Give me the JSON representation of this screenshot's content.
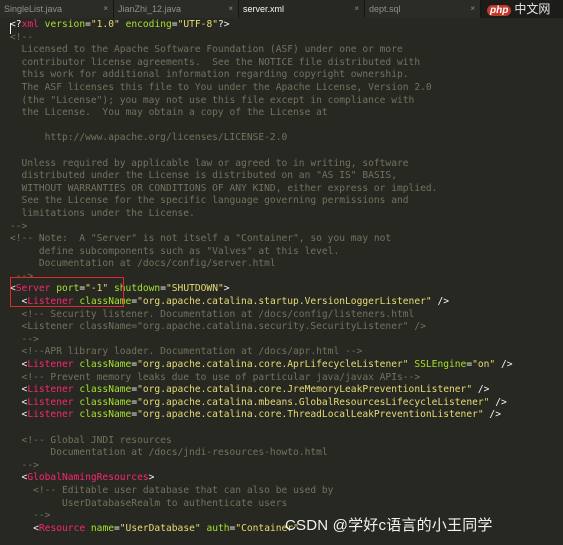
{
  "tabs": [
    {
      "label": "SingleList.java",
      "active": false
    },
    {
      "label": "JianZhi_12.java",
      "active": false
    },
    {
      "label": "server.xml",
      "active": true
    },
    {
      "label": "dept.sql",
      "active": false
    }
  ],
  "tab_close_glyph": "×",
  "logo": {
    "part1": "php",
    "part2": "中文网"
  },
  "watermark": "CSDN @学好c语言的小王同学",
  "lines": [
    [
      {
        "c": "p",
        "t": "<?"
      },
      {
        "c": "t",
        "t": "xml"
      },
      {
        "c": "p",
        "t": " "
      },
      {
        "c": "a",
        "t": "version"
      },
      {
        "c": "p",
        "t": "="
      },
      {
        "c": "s",
        "t": "\"1.0\""
      },
      {
        "c": "p",
        "t": " "
      },
      {
        "c": "a",
        "t": "encoding"
      },
      {
        "c": "p",
        "t": "="
      },
      {
        "c": "s",
        "t": "\"UTF-8\""
      },
      {
        "c": "p",
        "t": "?>"
      }
    ],
    [
      {
        "c": "c",
        "t": "<!--"
      }
    ],
    [
      {
        "c": "c",
        "t": "  Licensed to the Apache Software Foundation (ASF) under one or more"
      }
    ],
    [
      {
        "c": "c",
        "t": "  contributor license agreements.  See the NOTICE file distributed with"
      }
    ],
    [
      {
        "c": "c",
        "t": "  this work for additional information regarding copyright ownership."
      }
    ],
    [
      {
        "c": "c",
        "t": "  The ASF licenses this file to You under the Apache License, Version 2.0"
      }
    ],
    [
      {
        "c": "c",
        "t": "  (the \"License\"); you may not use this file except in compliance with"
      }
    ],
    [
      {
        "c": "c",
        "t": "  the License.  You may obtain a copy of the License at"
      }
    ],
    [
      {
        "c": "c",
        "t": ""
      }
    ],
    [
      {
        "c": "c",
        "t": "      http://www.apache.org/licenses/LICENSE-2.0"
      }
    ],
    [
      {
        "c": "c",
        "t": ""
      }
    ],
    [
      {
        "c": "c",
        "t": "  Unless required by applicable law or agreed to in writing, software"
      }
    ],
    [
      {
        "c": "c",
        "t": "  distributed under the License is distributed on an \"AS IS\" BASIS,"
      }
    ],
    [
      {
        "c": "c",
        "t": "  WITHOUT WARRANTIES OR CONDITIONS OF ANY KIND, either express or implied."
      }
    ],
    [
      {
        "c": "c",
        "t": "  See the License for the specific language governing permissions and"
      }
    ],
    [
      {
        "c": "c",
        "t": "  limitations under the License."
      }
    ],
    [
      {
        "c": "c",
        "t": "-->"
      }
    ],
    [
      {
        "c": "c",
        "t": "<!-- Note:  A \"Server\" is not itself a \"Container\", so you may not"
      }
    ],
    [
      {
        "c": "c",
        "t": "     define subcomponents such as \"Valves\" at this level."
      }
    ],
    [
      {
        "c": "c",
        "t": "     Documentation at /docs/config/server.html"
      }
    ],
    [
      {
        "c": "c",
        "t": " -->"
      }
    ],
    [
      {
        "c": "p",
        "t": "<"
      },
      {
        "c": "t",
        "t": "Server"
      },
      {
        "c": "p",
        "t": " "
      },
      {
        "c": "a",
        "t": "port"
      },
      {
        "c": "p",
        "t": "="
      },
      {
        "c": "s",
        "t": "\"-1\""
      },
      {
        "c": "p",
        "t": " "
      },
      {
        "c": "a",
        "t": "shutdown"
      },
      {
        "c": "p",
        "t": "="
      },
      {
        "c": "s",
        "t": "\"SHUTDOWN\""
      },
      {
        "c": "p",
        "t": ">"
      }
    ],
    [
      {
        "c": "p",
        "t": "  <"
      },
      {
        "c": "t",
        "t": "Listener"
      },
      {
        "c": "p",
        "t": " "
      },
      {
        "c": "a",
        "t": "className"
      },
      {
        "c": "p",
        "t": "="
      },
      {
        "c": "s",
        "t": "\"org.apache.catalina.startup.VersionLoggerListener\""
      },
      {
        "c": "p",
        "t": " />"
      }
    ],
    [
      {
        "c": "c",
        "t": "  <!-- Security listener. Documentation at /docs/config/listeners.html"
      }
    ],
    [
      {
        "c": "c",
        "t": "  <Listener className=\"org.apache.catalina.security.SecurityListener\" />"
      }
    ],
    [
      {
        "c": "c",
        "t": "  -->"
      }
    ],
    [
      {
        "c": "c",
        "t": "  <!--APR library loader. Documentation at /docs/apr.html -->"
      }
    ],
    [
      {
        "c": "p",
        "t": "  <"
      },
      {
        "c": "t",
        "t": "Listener"
      },
      {
        "c": "p",
        "t": " "
      },
      {
        "c": "a",
        "t": "className"
      },
      {
        "c": "p",
        "t": "="
      },
      {
        "c": "s",
        "t": "\"org.apache.catalina.core.AprLifecycleListener\""
      },
      {
        "c": "p",
        "t": " "
      },
      {
        "c": "a",
        "t": "SSLEngine"
      },
      {
        "c": "p",
        "t": "="
      },
      {
        "c": "s",
        "t": "\"on\""
      },
      {
        "c": "p",
        "t": " />"
      }
    ],
    [
      {
        "c": "c",
        "t": "  <!-- Prevent memory leaks due to use of particular java/javax APIs-->"
      }
    ],
    [
      {
        "c": "p",
        "t": "  <"
      },
      {
        "c": "t",
        "t": "Listener"
      },
      {
        "c": "p",
        "t": " "
      },
      {
        "c": "a",
        "t": "className"
      },
      {
        "c": "p",
        "t": "="
      },
      {
        "c": "s",
        "t": "\"org.apache.catalina.core.JreMemoryLeakPreventionListener\""
      },
      {
        "c": "p",
        "t": " />"
      }
    ],
    [
      {
        "c": "p",
        "t": "  <"
      },
      {
        "c": "t",
        "t": "Listener"
      },
      {
        "c": "p",
        "t": " "
      },
      {
        "c": "a",
        "t": "className"
      },
      {
        "c": "p",
        "t": "="
      },
      {
        "c": "s",
        "t": "\"org.apache.catalina.mbeans.GlobalResourcesLifecycleListener\""
      },
      {
        "c": "p",
        "t": " />"
      }
    ],
    [
      {
        "c": "p",
        "t": "  <"
      },
      {
        "c": "t",
        "t": "Listener"
      },
      {
        "c": "p",
        "t": " "
      },
      {
        "c": "a",
        "t": "className"
      },
      {
        "c": "p",
        "t": "="
      },
      {
        "c": "s",
        "t": "\"org.apache.catalina.core.ThreadLocalLeakPreventionListener\""
      },
      {
        "c": "p",
        "t": " />"
      }
    ],
    [
      {
        "c": "c",
        "t": ""
      }
    ],
    [
      {
        "c": "c",
        "t": "  <!-- Global JNDI resources"
      }
    ],
    [
      {
        "c": "c",
        "t": "       Documentation at /docs/jndi-resources-howto.html"
      }
    ],
    [
      {
        "c": "c",
        "t": "  -->"
      }
    ],
    [
      {
        "c": "p",
        "t": "  <"
      },
      {
        "c": "t",
        "t": "GlobalNamingResources"
      },
      {
        "c": "p",
        "t": ">"
      }
    ],
    [
      {
        "c": "c",
        "t": "    <!-- Editable user database that can also be used by"
      }
    ],
    [
      {
        "c": "c",
        "t": "         UserDatabaseRealm to authenticate users"
      }
    ],
    [
      {
        "c": "c",
        "t": "    -->"
      }
    ],
    [
      {
        "c": "p",
        "t": "    <"
      },
      {
        "c": "t",
        "t": "Resource"
      },
      {
        "c": "p",
        "t": " "
      },
      {
        "c": "a",
        "t": "name"
      },
      {
        "c": "p",
        "t": "="
      },
      {
        "c": "s",
        "t": "\"UserDatabase\""
      },
      {
        "c": "p",
        "t": " "
      },
      {
        "c": "a",
        "t": "auth"
      },
      {
        "c": "p",
        "t": "="
      },
      {
        "c": "s",
        "t": "\"Container\""
      }
    ]
  ]
}
